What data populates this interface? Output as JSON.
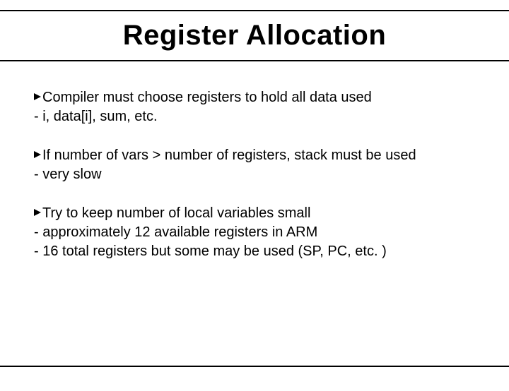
{
  "title": "Register Allocation",
  "bullets": [
    {
      "lead": "Compiler must choose registers to hold all data used",
      "subs": [
        "- i, data[i], sum, etc."
      ]
    },
    {
      "lead": "If number of vars > number of registers, stack must be used",
      "subs": [
        "- very slow"
      ]
    },
    {
      "lead": "Try to keep number of local variables small",
      "subs": [
        "- approximately 12 available registers in ARM",
        "- 16 total registers but some may be used (SP, PC, etc. )"
      ]
    }
  ]
}
